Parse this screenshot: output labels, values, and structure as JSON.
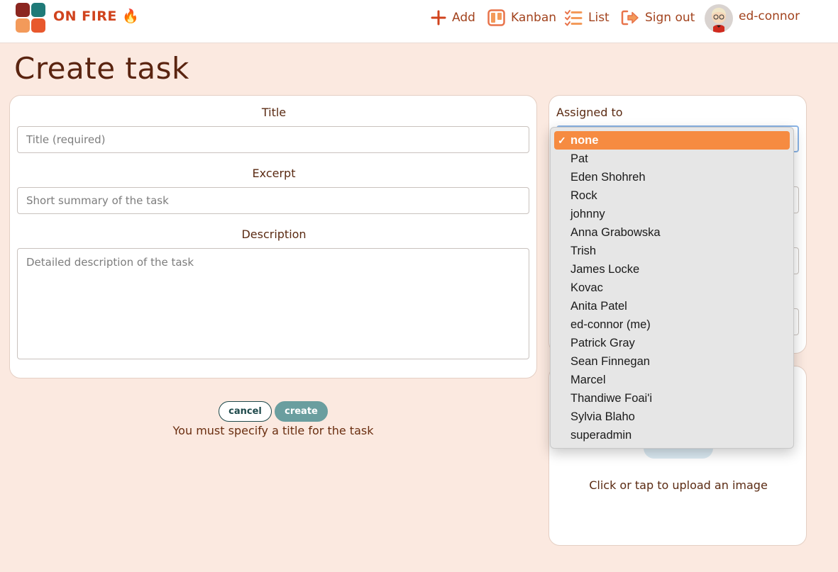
{
  "app": {
    "brand": "ON FIRE",
    "brand_emoji": "🔥"
  },
  "nav": {
    "add": "Add",
    "kanban": "Kanban",
    "list": "List",
    "signout": "Sign out",
    "username": "ed-connor"
  },
  "page": {
    "title": "Create task"
  },
  "form": {
    "title_label": "Title",
    "title_placeholder": "Title (required)",
    "excerpt_label": "Excerpt",
    "excerpt_placeholder": "Short summary of the task",
    "description_label": "Description",
    "description_placeholder": "Detailed description of the task",
    "cancel_label": "cancel",
    "create_label": "create",
    "error_message": "You must specify a title for the task"
  },
  "side": {
    "assigned_label": "Assigned to",
    "upload_hint": "Click or tap to upload an image"
  },
  "dropdown": {
    "check": "✓",
    "options": [
      "none",
      "Pat",
      "Eden Shohreh",
      "Rock",
      "johnny",
      "Anna Grabowska",
      "Trish",
      "James Locke",
      "Kovac",
      "Anita Patel",
      "ed-connor (me)",
      "Patrick Gray",
      "Sean Finnegan",
      "Marcel",
      "Thandiwe Foai'i",
      "Sylvia Blaho",
      "superadmin"
    ],
    "selected_index": 0
  },
  "colors": {
    "accent": "#f68b41",
    "brand": "#d0431d",
    "nav_text": "#a2431e",
    "background": "#fbe9e0",
    "create_button": "#6a9e9f"
  }
}
